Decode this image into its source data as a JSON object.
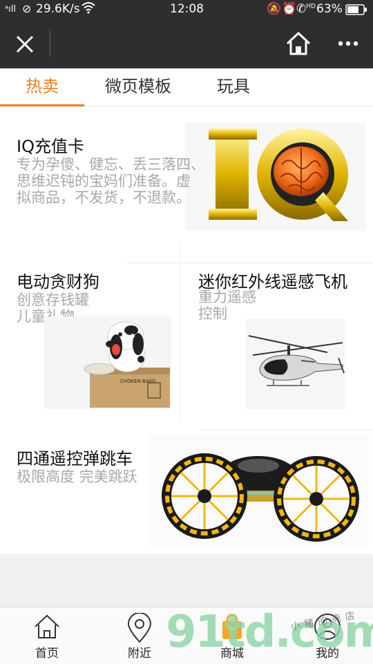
{
  "status_bar": {
    "speed": "29.6K/s",
    "time": "12:08",
    "battery": "63%",
    "hd": "HD"
  },
  "header": {
    "close_icon": "close-icon",
    "home_icon": "home-icon",
    "more_icon": "more-icon"
  },
  "tabs": [
    {
      "label": "热卖",
      "active": true
    },
    {
      "label": "微页模板",
      "active": false
    },
    {
      "label": "玩具",
      "active": false
    }
  ],
  "products": [
    {
      "title": "IQ充值卡",
      "subtitle_lines": [
        "专为孕傻、健忘、丢三落四、",
        "思维迟钝的宝妈们准备。虚",
        "拟商品，不发货，不退款。"
      ],
      "image": "iq-brain-image"
    },
    {
      "title": "电动贪财狗",
      "subtitle_lines": [
        "创意存钱罐",
        "儿童礼物"
      ],
      "image": "dog-bank-image",
      "box_text": "CHOKEN-BAKO"
    },
    {
      "title": "迷你红外线遥感飞机",
      "subtitle_lines": [
        "重力遥感",
        "控制"
      ],
      "image": "helicopter-image"
    },
    {
      "title": "四通遥控弹跳车",
      "subtitle_lines": [
        "极限高度 完美跳跃"
      ],
      "image": "bounce-car-image"
    }
  ],
  "bottom_nav": [
    {
      "label": "首页",
      "icon": "home-icon"
    },
    {
      "label": "附近",
      "icon": "location-pin-icon"
    },
    {
      "label": "商城",
      "icon": "shop-bag-icon"
    },
    {
      "label": "我的",
      "icon": "user-icon"
    }
  ],
  "watermark": {
    "text": "91td.com",
    "tagline": "小猪的商店"
  },
  "colors": {
    "accent": "#f07e1c",
    "header_bg": "#2e2e31",
    "watermark_green": "#8fd6a8",
    "watermark_orange": "#f6a623"
  }
}
